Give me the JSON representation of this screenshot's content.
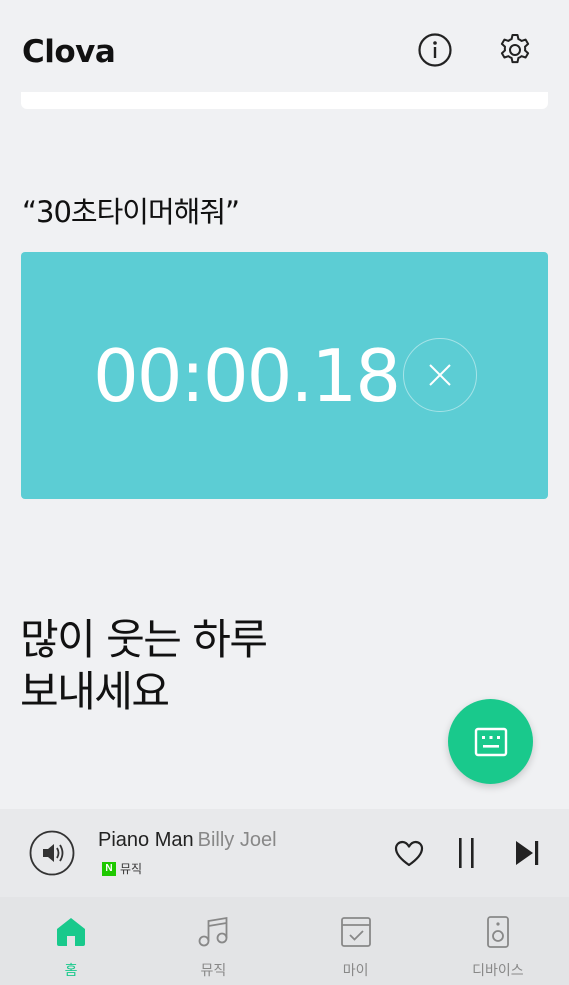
{
  "header": {
    "title": "Clova",
    "info_icon": "info-icon",
    "settings_icon": "gear-icon"
  },
  "voice_command": "“30초타이머해줘”",
  "timer": {
    "time": "00:00.18",
    "cancel_icon": "close-icon"
  },
  "greeting": {
    "line1": "많이 웃는 하루",
    "line2": "보내세요"
  },
  "fab": {
    "icon": "keyboard-icon"
  },
  "player": {
    "title": "Piano Man",
    "artist": "Billy Joel",
    "source_badge": "N",
    "source": "뮤직",
    "icons": [
      "speaker-icon",
      "heart-icon",
      "pause-icon",
      "skip-next-icon"
    ]
  },
  "nav": [
    {
      "label": "홈",
      "icon": "home-icon",
      "active": true
    },
    {
      "label": "뮤직",
      "icon": "music-note-icon",
      "active": false
    },
    {
      "label": "마이",
      "icon": "calendar-check-icon",
      "active": false
    },
    {
      "label": "디바이스",
      "icon": "speaker-device-icon",
      "active": false
    }
  ],
  "colors": {
    "accent": "#19c98c",
    "timer_bg": "#5ccdd4",
    "background": "#f0f1f3",
    "naver_green": "#1ec800"
  }
}
